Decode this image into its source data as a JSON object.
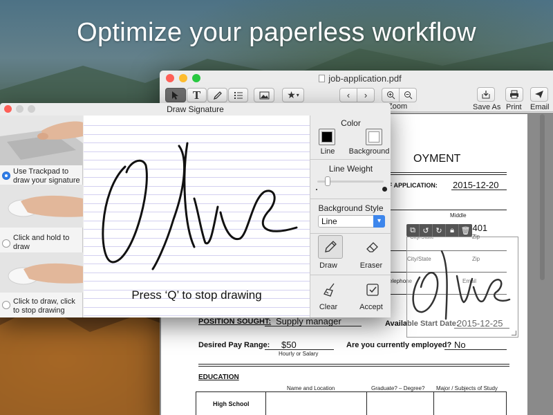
{
  "headline": "Optimize your paperless workflow",
  "pdf_window": {
    "title": "job-application.pdf",
    "toolbar": {
      "tools": [
        "select-tool",
        "text-tool",
        "sign-tool",
        "list-tool",
        "image-tool",
        "favorites-tool"
      ],
      "text_tool_glyph": "T",
      "zoom_label": "Zoom",
      "save_as_label": "Save As",
      "print_label": "Print",
      "email_label": "Email"
    },
    "form": {
      "heading_partial": "OYMENT",
      "date_of_application_label": "ATE OF APPLICATION:",
      "date_of_application_value": "2015-12-20",
      "middle_label": "Middle",
      "state_partial": "OR",
      "zip_partial": "97401",
      "city_state_small": "City/State",
      "zip_small_1": "Zip",
      "city_state_label": "City/State",
      "zip_label_2": "Zip",
      "telephone_partial": "elephone",
      "email_label": "Email",
      "position_sought_label": "POSITION SOUGHT:",
      "position_sought_value": "Supply manager",
      "available_start_label": "Available Start Date:",
      "available_start_value": "2015-12-25",
      "desired_pay_label": "Desired Pay Range:",
      "desired_pay_value": "$50",
      "hourly_label": "Hourly or Salary",
      "employed_label": "Are you currently employed?",
      "employed_value": "No",
      "education_label": "EDUCATION",
      "col_name_location": "Name and Location",
      "col_graduate": "Graduate? – Degree?",
      "col_major": "Major / Subjects of Study",
      "row_high_school": "High School"
    }
  },
  "dialog": {
    "title": "Draw Signature",
    "methods": [
      {
        "label_line1": "Use Trackpad to",
        "label_line2": "draw your signature",
        "selected": true
      },
      {
        "label_line1": "Click and hold to",
        "label_line2": "draw",
        "selected": false
      },
      {
        "label_line1": "Click to draw, click",
        "label_line2": "to stop drawing",
        "selected": false
      }
    ],
    "canvas_hint": "Press ‘Q’ to stop drawing",
    "color_heading": "Color",
    "line_label": "Line",
    "background_label": "Background",
    "line_color": "#000000",
    "background_color": "#ffffff",
    "line_weight_heading": "Line Weight",
    "line_weight_fraction": 0.12,
    "background_style_heading": "Background Style",
    "background_style_value": "Line",
    "draw_label": "Draw",
    "eraser_label": "Eraser",
    "clear_label": "Clear",
    "accept_label": "Accept"
  },
  "colors": {
    "accent": "#2f7de8",
    "canvas_rule": "#d3d0f0",
    "close": "#fe5f57",
    "minimize": "#febc2e",
    "zoom": "#28c840"
  }
}
